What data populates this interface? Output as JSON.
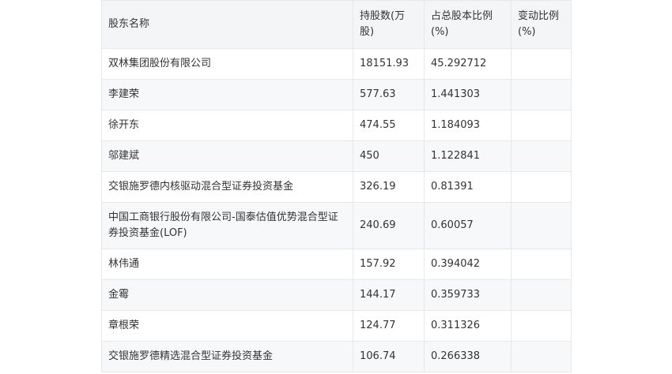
{
  "table": {
    "headers": [
      "股东名称",
      "持股数(万股)",
      "占总股本比例(%)",
      "变动比例(%)"
    ],
    "rows": [
      [
        "双林集团股份有限公司",
        "18151.93",
        "45.292712",
        ""
      ],
      [
        "李建荣",
        "577.63",
        "1.441303",
        ""
      ],
      [
        "徐开东",
        "474.55",
        "1.184093",
        ""
      ],
      [
        "邬建斌",
        "450",
        "1.122841",
        ""
      ],
      [
        "交银施罗德内核驱动混合型证券投资基金",
        "326.19",
        "0.81391",
        ""
      ],
      [
        "中国工商银行股份有限公司-国泰估值优势混合型证券投资基金(LOF)",
        "240.69",
        "0.60057",
        ""
      ],
      [
        "林伟通",
        "157.92",
        "0.394042",
        ""
      ],
      [
        "金霉",
        "144.17",
        "0.359733",
        ""
      ],
      [
        "章根荣",
        "124.77",
        "0.311326",
        ""
      ],
      [
        "交银施罗德精选混合型证券投资基金",
        "106.74",
        "0.266338",
        ""
      ]
    ]
  }
}
